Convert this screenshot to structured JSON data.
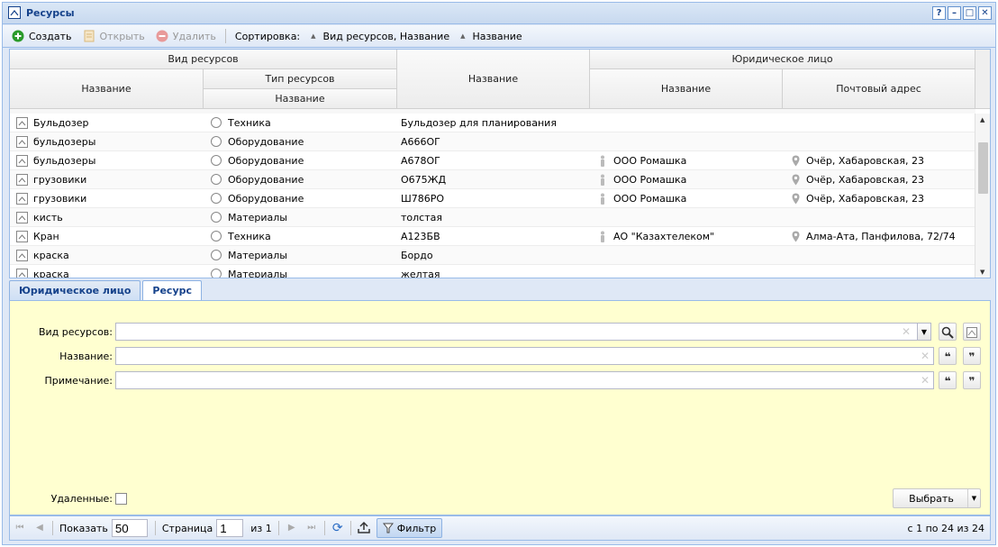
{
  "window": {
    "title": "Ресурсы",
    "buttons": [
      "?",
      "–",
      "□",
      "✕"
    ]
  },
  "toolbar": {
    "create_label": "Создать",
    "open_label": "Открыть",
    "delete_label": "Удалить",
    "sort_label": "Сортировка:",
    "sort_items": [
      "Вид ресурсов, Название",
      "Название"
    ]
  },
  "grid": {
    "headers": {
      "resource_kind": "Вид ресурсов",
      "kind_name": "Название",
      "resource_type": "Тип ресурсов",
      "type_name": "Название",
      "name": "Название",
      "legal_entity": "Юридическое лицо",
      "entity_name": "Название",
      "postal_address": "Почтовый адрес"
    },
    "rows": [
      {
        "kind": "Бульдозер",
        "type": "Техника",
        "name": "Бульдозер для планирования",
        "entity": "",
        "address": ""
      },
      {
        "kind": "бульдозеры",
        "type": "Оборудование",
        "name": "А666ОГ",
        "entity": "",
        "address": ""
      },
      {
        "kind": "бульдозеры",
        "type": "Оборудование",
        "name": "А678ОГ",
        "entity": "ООО Ромашка",
        "address": "Очёр, Хабаровская, 23"
      },
      {
        "kind": "грузовики",
        "type": "Оборудование",
        "name": "О675ЖД",
        "entity": "ООО Ромашка",
        "address": "Очёр, Хабаровская, 23"
      },
      {
        "kind": "грузовики",
        "type": "Оборудование",
        "name": "Ш786РО",
        "entity": "ООО Ромашка",
        "address": "Очёр, Хабаровская, 23"
      },
      {
        "kind": "кисть",
        "type": "Материалы",
        "name": "толстая",
        "entity": "",
        "address": ""
      },
      {
        "kind": "Кран",
        "type": "Техника",
        "name": "А123БВ",
        "entity": "АО \"Казахтелеком\"",
        "address": "Алма-Ата, Панфилова, 72/74"
      },
      {
        "kind": "краска",
        "type": "Материалы",
        "name": "Бордо",
        "entity": "",
        "address": ""
      },
      {
        "kind": "краска",
        "type": "Материалы",
        "name": "желтая",
        "entity": "",
        "address": ""
      }
    ]
  },
  "tabs": [
    {
      "label": "Юридическое лицо",
      "active": false
    },
    {
      "label": "Ресурс",
      "active": true
    }
  ],
  "form": {
    "kind_label": "Вид ресурсов:",
    "name_label": "Название:",
    "note_label": "Примечание:",
    "kind_value": "",
    "name_value": "",
    "note_value": "",
    "deleted_label": "Удаленные:",
    "select_label": "Выбрать"
  },
  "paging": {
    "show_label": "Показать",
    "page_size": "50",
    "page_label": "Страница",
    "page_value": "1",
    "of_label": "из 1",
    "filter_label": "Фильтр",
    "summary": "с 1 по 24 из 24"
  }
}
